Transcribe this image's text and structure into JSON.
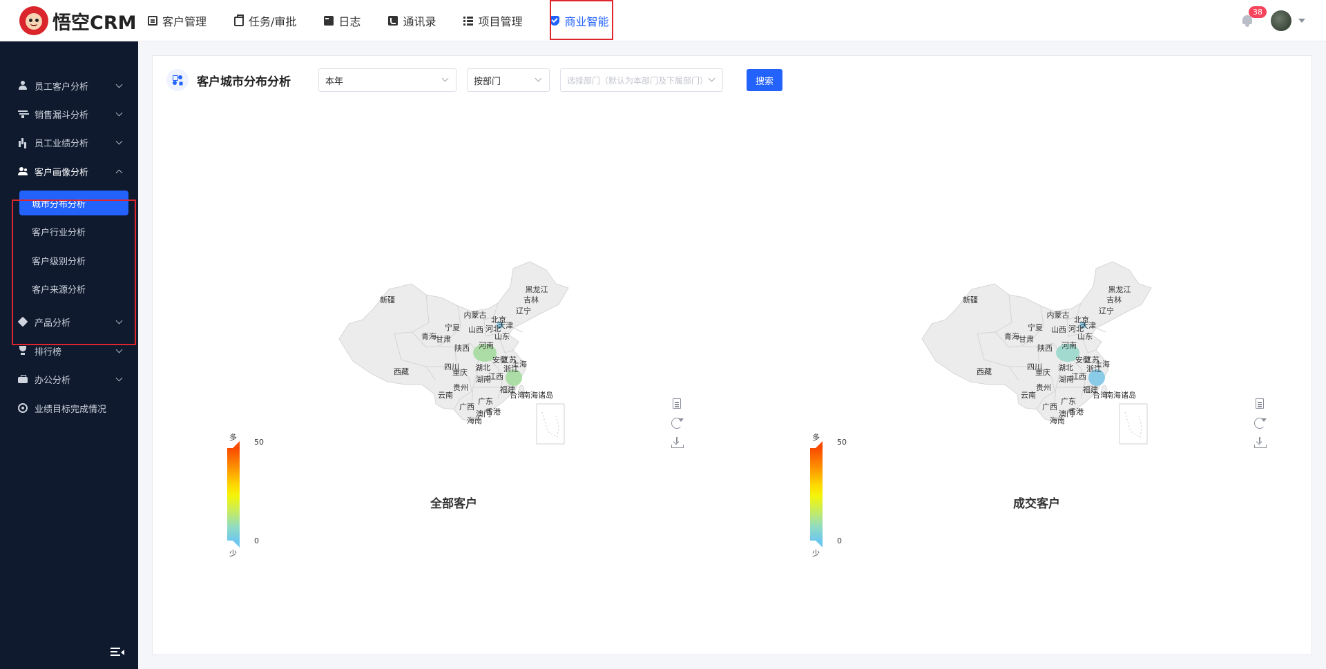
{
  "app": {
    "logo_text": "悟空CRM"
  },
  "nav": [
    {
      "label": "客户管理",
      "icon": "doc-icon"
    },
    {
      "label": "任务/审批",
      "icon": "briefcase-icon"
    },
    {
      "label": "日志",
      "icon": "book-icon"
    },
    {
      "label": "通讯录",
      "icon": "phone-icon"
    },
    {
      "label": "项目管理",
      "icon": "list-icon"
    },
    {
      "label": "商业智能",
      "icon": "shield-check-icon",
      "active": true
    }
  ],
  "header": {
    "notification_count": "38"
  },
  "sidebar": {
    "groups": [
      {
        "label": "员工客户分析",
        "icon": "user-icon"
      },
      {
        "label": "销售漏斗分析",
        "icon": "funnel-icon"
      },
      {
        "label": "员工业绩分析",
        "icon": "bar-chart-icon"
      },
      {
        "label": "客户画像分析",
        "icon": "users-icon",
        "open": true,
        "children": [
          {
            "label": "城市分布分析",
            "active": true
          },
          {
            "label": "客户行业分析"
          },
          {
            "label": "客户级别分析"
          },
          {
            "label": "客户来源分析"
          }
        ]
      },
      {
        "label": "产品分析",
        "icon": "cube-icon"
      },
      {
        "label": "排行榜",
        "icon": "trophy-icon"
      },
      {
        "label": "办公分析",
        "icon": "briefcase-icon"
      },
      {
        "label": "业绩目标完成情况",
        "icon": "target-icon"
      }
    ]
  },
  "toolbar": {
    "title": "客户城市分布分析",
    "period_value": "本年",
    "scope_value": "按部门",
    "dept_placeholder": "选择部门（默认为本部门及下属部门）",
    "search_label": "搜索"
  },
  "maps": [
    {
      "title": "全部客户",
      "legend": {
        "high_label": "多",
        "low_label": "少",
        "max": "50",
        "min": "0"
      },
      "highlighted": [
        {
          "province": "河南",
          "color": "#a6dca0"
        },
        {
          "province": "浙江",
          "color": "#a6dca0"
        },
        {
          "province": "北京",
          "color": "#7fc8e8"
        }
      ]
    },
    {
      "title": "成交客户",
      "legend": {
        "high_label": "多",
        "low_label": "少",
        "max": "50",
        "min": "0"
      },
      "highlighted": [
        {
          "province": "河南",
          "color": "#9ad8cc"
        },
        {
          "province": "浙江",
          "color": "#7fc8e8"
        },
        {
          "province": "北京",
          "color": "#7fc8e8"
        }
      ]
    }
  ],
  "provinces": [
    "黑龙江",
    "吉林",
    "辽宁",
    "内蒙古",
    "北京",
    "天津",
    "河北",
    "山西",
    "宁夏",
    "青海",
    "甘肃",
    "陕西",
    "河南",
    "山东",
    "新疆",
    "西藏",
    "四川",
    "重庆",
    "湖北",
    "安徽",
    "江苏",
    "上海",
    "浙江",
    "湖南",
    "江西",
    "贵州",
    "云南",
    "福建",
    "广西",
    "广东",
    "台湾",
    "澳门",
    "香港",
    "海南",
    "南海诸岛"
  ],
  "colors": {
    "accent": "#2362fb",
    "sidebar_bg": "#0f1a2e",
    "highlight_box": "#e0262d",
    "map_fill": "#ececec"
  }
}
